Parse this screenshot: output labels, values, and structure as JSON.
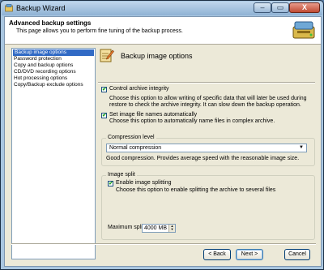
{
  "window": {
    "title": "Backup Wizard",
    "min_symbol": "–",
    "max_symbol": "▭",
    "close_symbol": "X"
  },
  "header": {
    "title": "Advanced backup settings",
    "subtitle": "This page allows you to perform fine tuning of the backup process."
  },
  "nav": {
    "items": [
      {
        "label": "Backup image options",
        "selected": true
      },
      {
        "label": "Password protection",
        "selected": false
      },
      {
        "label": "Copy and backup options",
        "selected": false
      },
      {
        "label": "CD/DVD recording options",
        "selected": false
      },
      {
        "label": "Hot processing options",
        "selected": false
      },
      {
        "label": "Copy/Backup exclude options",
        "selected": false
      }
    ]
  },
  "section": {
    "title": "Backup image options",
    "icon": "pencil-document-icon"
  },
  "control_integrity": {
    "label": "Control archive integrity",
    "checked": true,
    "check_glyph": "✔",
    "description": "Choose this option to allow writing of specific data that will later be used during restore to check the archive integrity. It can slow down the backup operation."
  },
  "set_names": {
    "label": "Set image file names automatically",
    "checked": true,
    "check_glyph": "✔",
    "description": "Choose this option to automatically name files in complex archive."
  },
  "compression": {
    "group_label": "Compression level",
    "selected": "Normal compression",
    "arrow": "▼",
    "description": "Good compression. Provides average speed with the reasonable image size."
  },
  "image_split": {
    "group_label": "Image split",
    "enable_label": "Enable image splitting",
    "checked": true,
    "check_glyph": "✔",
    "description": "Choose this option to enable splitting the archive to several files",
    "max_size_label": "Maximum split size",
    "max_size_value": "4000 MB",
    "spin_up": "▲",
    "spin_down": "▼"
  },
  "buttons": {
    "back": "< Back",
    "next": "Next >",
    "cancel": "Cancel"
  },
  "colors": {
    "selection": "#316ac5",
    "dialog_bg": "#ece9d8",
    "accent_border": "#7f9db9"
  }
}
